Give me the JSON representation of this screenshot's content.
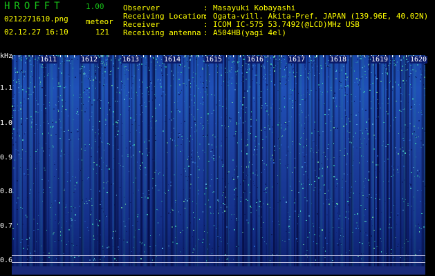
{
  "header": {
    "app_title": "HROFFT",
    "app_version": "1.00",
    "file_name": "0212271610.png",
    "mode_label": "meteor",
    "datetime": "02.12.27 16:10",
    "count": "121"
  },
  "info": [
    {
      "key": "Observer",
      "sep": ":",
      "value": "Masayuki Kobayashi"
    },
    {
      "key": "Receiving Location",
      "sep": ":",
      "value": "Ogata-vill. Akita-Pref. JAPAN (139.96E, 40.02N)"
    },
    {
      "key": "Receiver",
      "sep": ":",
      "value": "ICOM IC-575 53.7492(@LCD)MHz USB"
    },
    {
      "key": "Receiving antenna",
      "sep": ":",
      "value": "A504HB(yagi 4el)"
    }
  ],
  "axis": {
    "unit": "kHz",
    "freq_labels": [
      "1.1",
      "1.0",
      "0.9",
      "0.8",
      "0.7",
      "0.6"
    ],
    "time_labels": [
      "1611",
      "1612",
      "1613",
      "1614",
      "1615",
      "1616",
      "1617",
      "1618",
      "1619",
      "1620"
    ]
  },
  "colors": {
    "title_green": "#18c018",
    "text_yellow": "#ffff00",
    "spectrum_blue": "#1f50b8",
    "meteor_echo": "#ffff00"
  }
}
